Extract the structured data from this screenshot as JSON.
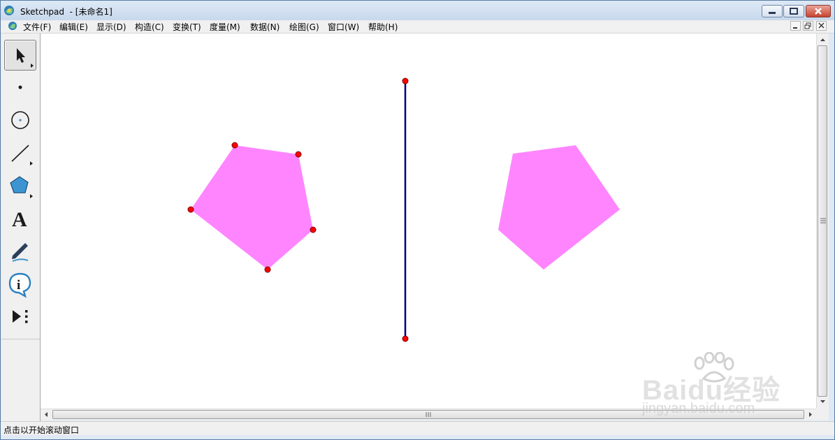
{
  "window": {
    "app_name": "Sketchpad",
    "title": "Sketchpad  - [未命名1]"
  },
  "menu": {
    "items": [
      {
        "label": "文件(F)"
      },
      {
        "label": "编辑(E)"
      },
      {
        "label": "显示(D)"
      },
      {
        "label": "构造(C)"
      },
      {
        "label": "变换(T)"
      },
      {
        "label": "度量(M)"
      },
      {
        "label": "数据(N)"
      },
      {
        "label": "绘图(G)"
      },
      {
        "label": "窗口(W)"
      },
      {
        "label": "帮助(H)"
      }
    ]
  },
  "toolbox": {
    "tools": [
      {
        "name": "arrow-tool",
        "icon": "select-arrow-icon",
        "active": true
      },
      {
        "name": "point-tool",
        "icon": "point-icon"
      },
      {
        "name": "compass-tool",
        "icon": "compass-circle-icon"
      },
      {
        "name": "straightedge-tool",
        "icon": "segment-icon"
      },
      {
        "name": "polygon-tool",
        "icon": "pentagon-icon"
      },
      {
        "name": "text-tool",
        "icon": "text-A-icon",
        "glyph": "A"
      },
      {
        "name": "marker-tool",
        "icon": "pen-icon"
      },
      {
        "name": "information-tool",
        "icon": "info-icon",
        "glyph": "i"
      },
      {
        "name": "custom-tool",
        "icon": "play-custom-icon"
      }
    ]
  },
  "canvas": {
    "fill_color": "#ff85ff",
    "mirror_color": "#000080",
    "point_color": "#ff0000"
  },
  "statusbar": {
    "text": "点击以开始滚动窗口"
  },
  "watermark": {
    "brand": "Baidu经验",
    "url": "jingyan.baidu.com"
  }
}
